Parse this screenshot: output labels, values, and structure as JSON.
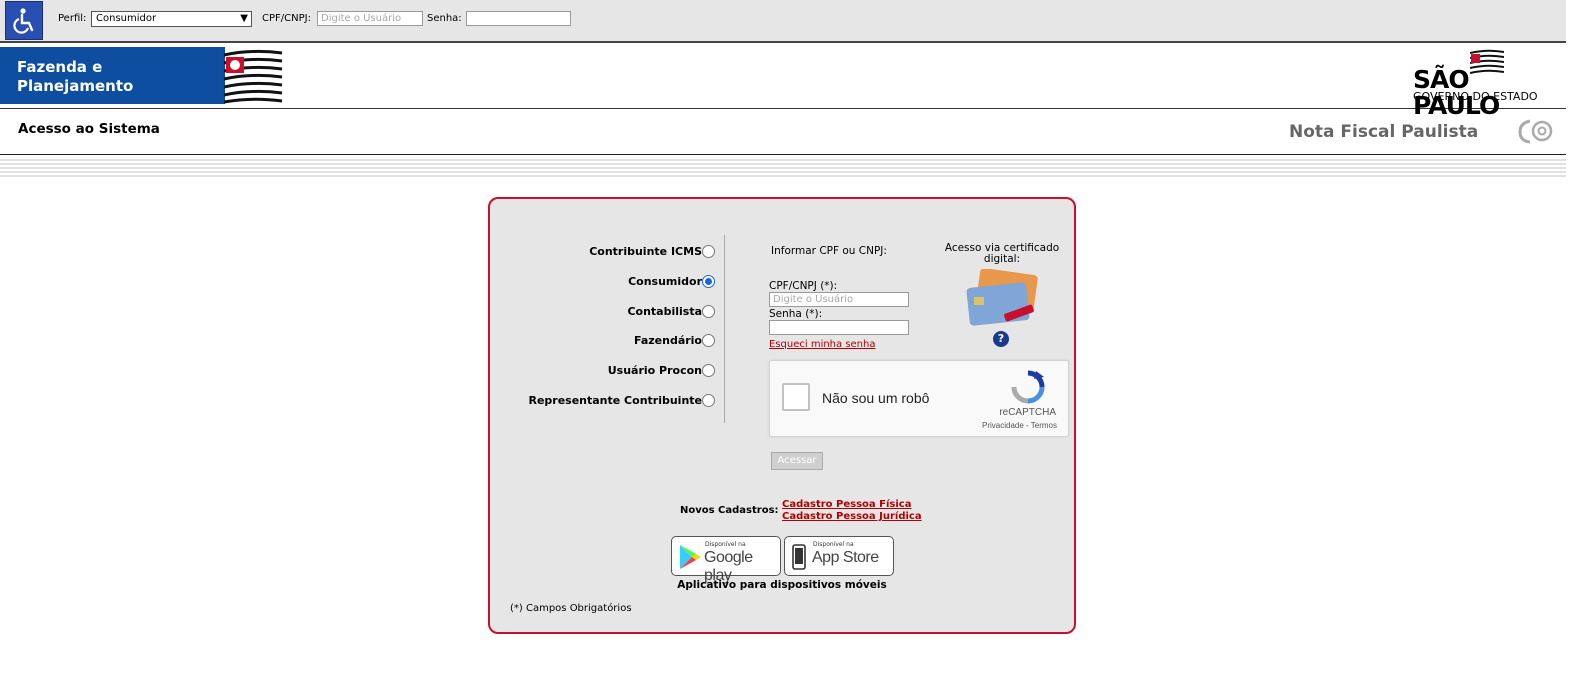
{
  "topbar": {
    "perfil_label": "Perfil:",
    "perfil_value": "Consumidor",
    "cpf_label": "CPF/CNPJ:",
    "cpf_placeholder": "Digite o Usuário",
    "senha_label": "Senha:"
  },
  "banner": {
    "fazenda_line1": "Fazenda e",
    "fazenda_line2": "Planejamento",
    "sp_title": "SÃO PAULO",
    "sp_subtitle": "GOVERNO DO ESTADO"
  },
  "header": {
    "left_title": "Acesso ao Sistema",
    "right_title": "Nota Fiscal Paulista"
  },
  "login": {
    "roles": [
      {
        "label": "Contribuinte ICMS",
        "selected": false
      },
      {
        "label": "Consumidor",
        "selected": true
      },
      {
        "label": "Contabilista",
        "selected": false
      },
      {
        "label": "Fazendário",
        "selected": false
      },
      {
        "label": "Usuário Procon",
        "selected": false
      },
      {
        "label": "Representante Contribuinte",
        "selected": false
      }
    ],
    "informar": "Informar CPF ou CNPJ:",
    "cpf_label": "CPF/CNPJ (*):",
    "cpf_placeholder": "Digite o Usuário",
    "senha_label": "Senha (*):",
    "forgot": "Esqueci minha senha",
    "cert_label": "Acesso via certificado digital:",
    "help": "?",
    "captcha": {
      "label": "Não sou um robô",
      "brand": "reCAPTCHA",
      "links": "Privacidade - Termos"
    },
    "submit": "Acessar",
    "novos_label": "Novos Cadastros:",
    "link_pf": "Cadastro Pessoa Física",
    "link_pj": "Cadastro Pessoa Jurídica",
    "google_small": "Disponível na",
    "google_big": "Google play",
    "apple_small": "Disponível na",
    "apple_big": "App Store",
    "apps_caption": "Aplicativo para dispositivos móveis",
    "required_note": "(*) Campos Obrigatórios"
  },
  "colors": {
    "fazenda_blue": "#0d4ea0",
    "box_border": "#c8102e",
    "link_red": "#b30000"
  }
}
